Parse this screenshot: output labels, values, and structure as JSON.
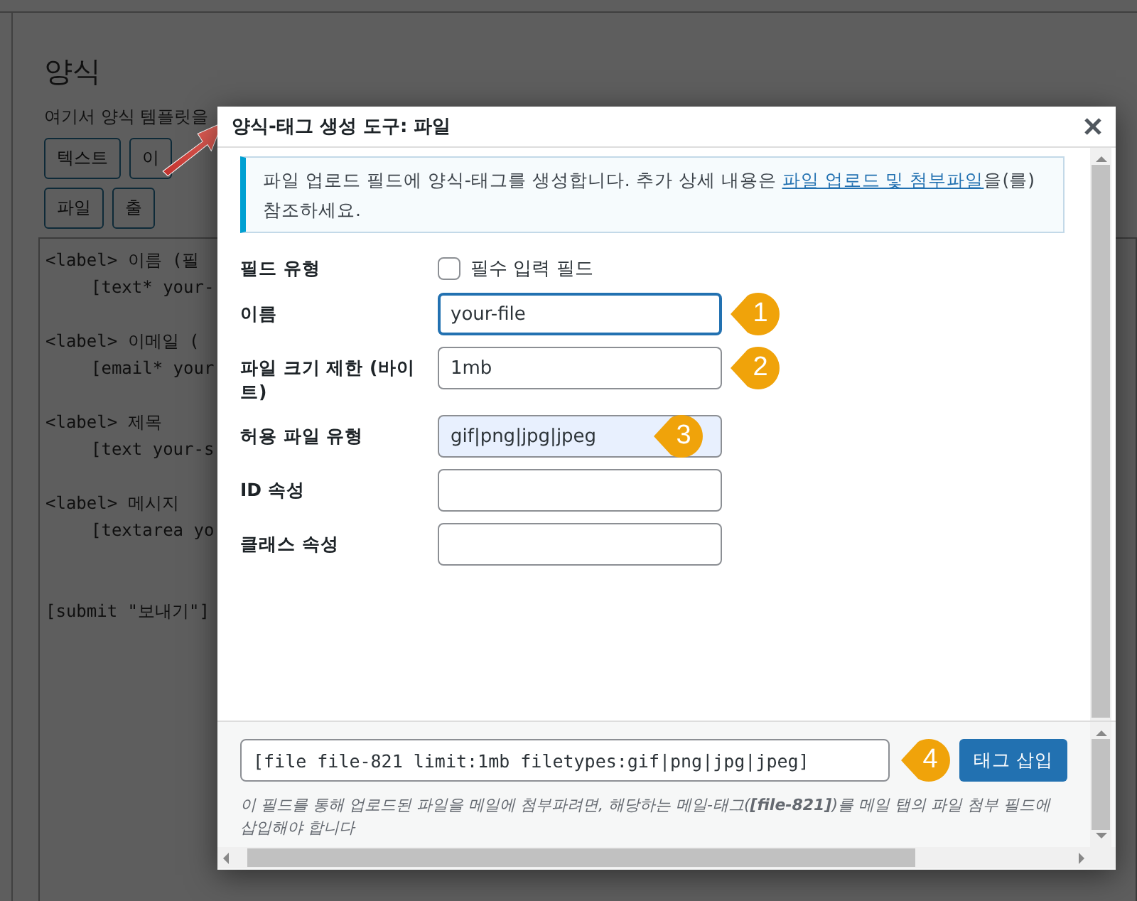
{
  "background": {
    "heading": "양식",
    "description": "여기서 양식 템플릿을",
    "tag_button_rows": [
      [
        "텍스트",
        "이"
      ],
      [
        "파일",
        "출"
      ]
    ],
    "code_blocks": [
      [
        "<label> 이름 (필",
        "[text* your-"
      ],
      [
        "<label> 이메일 (",
        "[email* your"
      ],
      [
        "<label> 제목",
        "[text your-s"
      ],
      [
        "<label> 메시지",
        "[textarea yo"
      ],
      [
        "[submit \"보내기\"]"
      ]
    ]
  },
  "dialog": {
    "title": "양식-태그 생성 도구: 파일",
    "notice": {
      "before": "파일 업로드 필드에 양식-태그를 생성합니다. 추가 상세 내용은 ",
      "link": "파일 업로드 및 첨부파일",
      "after": "을(를) 참조하세요."
    },
    "fields": [
      {
        "kind": "checkbox",
        "label": "필드 유형",
        "option": "필수 입력 필드",
        "checked": false
      },
      {
        "kind": "text",
        "label": "이름",
        "value": "your-file",
        "focused": true,
        "highlighted": false,
        "marker": "1"
      },
      {
        "kind": "text",
        "label": "파일 크기 제한 (바이트)",
        "value": "1mb",
        "focused": false,
        "highlighted": false,
        "marker": "2"
      },
      {
        "kind": "text",
        "label": "허용 파일 유형",
        "value": "gif|png|jpg|jpeg",
        "focused": false,
        "highlighted": true,
        "marker": "3"
      },
      {
        "kind": "text",
        "label": "ID 속성",
        "focused": false,
        "highlighted": false
      },
      {
        "kind": "text",
        "label": "클래스 속성",
        "focused": false,
        "highlighted": false
      }
    ],
    "tag_code": "[file file-821 limit:1mb filetypes:gif|png|jpg|jpeg]",
    "insert_marker": "4",
    "insert_button": "태그 삽입",
    "footer_note": "이 필드를 통해 업로드된 파일을 메일에 첨부파려면, 해당하는 메일-태그(**[file-821]**)를 메일 탭의 파일 첨부 필드에 삽입해야 합니다"
  }
}
